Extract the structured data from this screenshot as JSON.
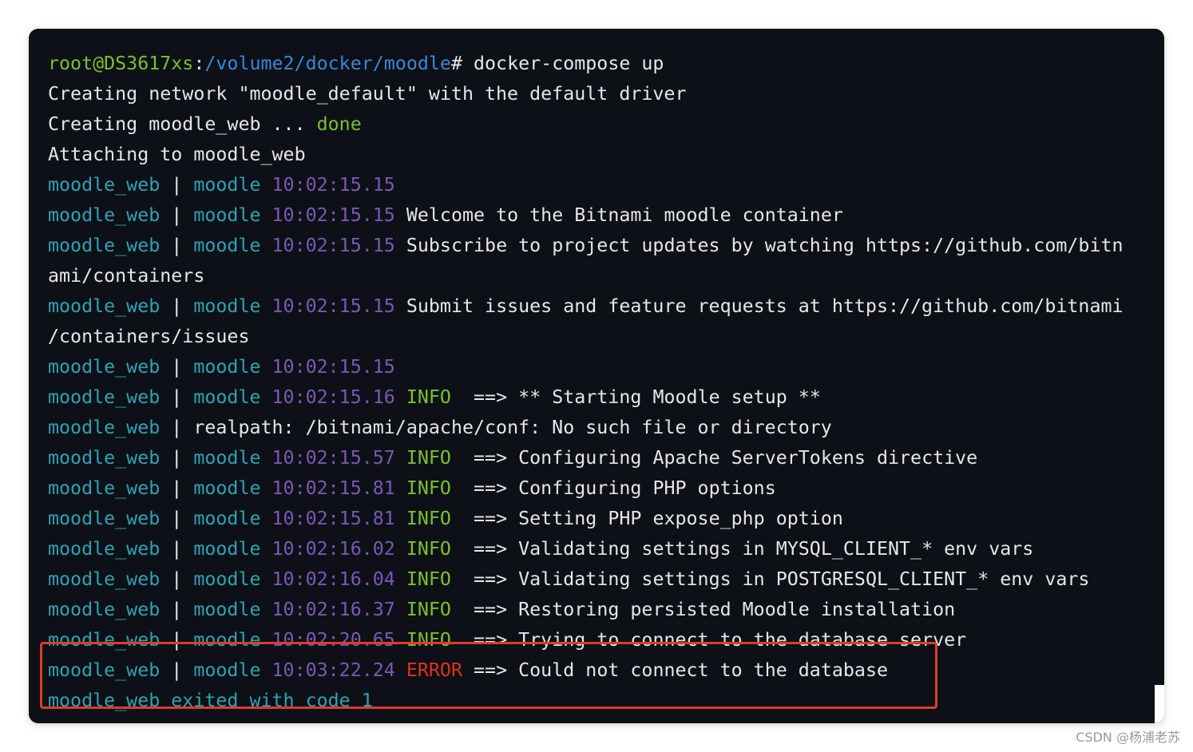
{
  "terminal": {
    "prompt": {
      "user_host": "root@DS3617xs",
      "separator": ":",
      "path": "/volume2/docker/moodle",
      "symbol": "#",
      "command": " docker-compose up"
    },
    "intro": {
      "network": "Creating network \"moodle_default\" with the default driver",
      "creating_prefix": "Creating moodle_web ... ",
      "done": "done",
      "attaching": "Attaching to moodle_web"
    },
    "log_prefix": "moodle_web",
    "pipe": " | ",
    "app": "moodle",
    "rows": [
      {
        "ts": "10:02:15.15",
        "level": "",
        "msg": ""
      },
      {
        "ts": "10:02:15.15",
        "level": "",
        "msg": "Welcome to the Bitnami moodle container"
      },
      {
        "ts": "10:02:15.15",
        "level": "",
        "msg": "Subscribe to project updates by watching https://github.com/bitn",
        "wrap": "ami/containers"
      },
      {
        "ts": "10:02:15.15",
        "level": "",
        "msg": "Submit issues and feature requests at https://github.com/bitnami",
        "wrap": "/containers/issues"
      },
      {
        "ts": "10:02:15.15",
        "level": "",
        "msg": ""
      },
      {
        "ts": "10:02:15.16",
        "level": "INFO",
        "msg": "==> ** Starting Moodle setup **"
      },
      {
        "raw": "realpath: /bitnami/apache/conf: No such file or directory"
      },
      {
        "ts": "10:02:15.57",
        "level": "INFO",
        "msg": "==> Configuring Apache ServerTokens directive"
      },
      {
        "ts": "10:02:15.81",
        "level": "INFO",
        "msg": "==> Configuring PHP options"
      },
      {
        "ts": "10:02:15.81",
        "level": "INFO",
        "msg": "==> Setting PHP expose_php option"
      },
      {
        "ts": "10:02:16.02",
        "level": "INFO",
        "msg": "==> Validating settings in MYSQL_CLIENT_* env vars"
      },
      {
        "ts": "10:02:16.04",
        "level": "INFO",
        "msg": "==> Validating settings in POSTGRESQL_CLIENT_* env vars"
      },
      {
        "ts": "10:02:16.37",
        "level": "INFO",
        "msg": "==> Restoring persisted Moodle installation"
      },
      {
        "ts": "10:02:20.65",
        "level": "INFO",
        "msg": "==> Trying to connect to the database server"
      },
      {
        "ts": "10:03:22.24",
        "level": "ERROR",
        "msg": "==> Could not connect to the database"
      }
    ],
    "exit_line": "moodle_web exited with code 1"
  },
  "colors": {
    "background": "#0d1117",
    "prompt_user": "#79c12b",
    "prompt_path": "#3a86d6",
    "container": "#2ea2b5",
    "timestamp": "#7d56b6",
    "info": "#79c12b",
    "error": "#e0301e",
    "highlight_border": "#e13a2b"
  },
  "watermark": "CSDN @杨浦老苏"
}
